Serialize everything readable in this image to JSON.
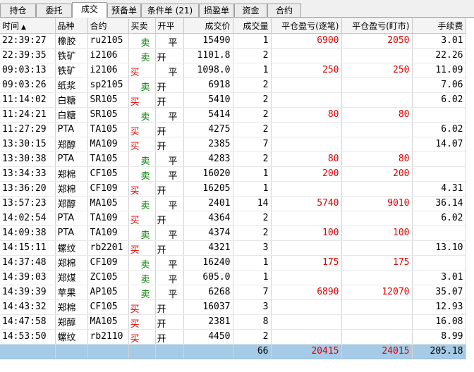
{
  "tabs": [
    "持仓",
    "委托",
    "成交",
    "预备单",
    "条件单 (21)",
    "损盈单",
    "资金",
    "合约"
  ],
  "active_tab": "成交",
  "columns": [
    "时间",
    "品种",
    "合约",
    "买卖",
    "开平",
    "成交价",
    "成交量",
    "平仓盈亏(逐笔)",
    "平仓盈亏(盯市)",
    "手续费"
  ],
  "sort_indicator": "▲",
  "rows": [
    {
      "time": "22:39:27",
      "product": "橡胶",
      "contract": "ru2105",
      "side": "卖",
      "oc": "平",
      "price": "15490",
      "qty": "1",
      "pnl_trade": "6900",
      "pnl_mtm": "2050",
      "fee": "3.01"
    },
    {
      "time": "22:39:35",
      "product": "铁矿",
      "contract": "i2106",
      "side": "卖",
      "oc": "开",
      "price": "1101.8",
      "qty": "2",
      "pnl_trade": "",
      "pnl_mtm": "",
      "fee": "22.26"
    },
    {
      "time": "09:03:13",
      "product": "铁矿",
      "contract": "i2106",
      "side": "买",
      "oc": "平",
      "price": "1098.0",
      "qty": "1",
      "pnl_trade": "250",
      "pnl_mtm": "250",
      "fee": "11.09"
    },
    {
      "time": "09:03:26",
      "product": "纸浆",
      "contract": "sp2105",
      "side": "卖",
      "oc": "开",
      "price": "6918",
      "qty": "2",
      "pnl_trade": "",
      "pnl_mtm": "",
      "fee": "7.06"
    },
    {
      "time": "11:14:02",
      "product": "白糖",
      "contract": "SR105",
      "side": "买",
      "oc": "开",
      "price": "5410",
      "qty": "2",
      "pnl_trade": "",
      "pnl_mtm": "",
      "fee": "6.02"
    },
    {
      "time": "11:24:21",
      "product": "白糖",
      "contract": "SR105",
      "side": "卖",
      "oc": "平",
      "price": "5414",
      "qty": "2",
      "pnl_trade": "80",
      "pnl_mtm": "80",
      "fee": ""
    },
    {
      "time": "11:27:29",
      "product": "PTA",
      "contract": "TA105",
      "side": "买",
      "oc": "开",
      "price": "4275",
      "qty": "2",
      "pnl_trade": "",
      "pnl_mtm": "",
      "fee": "6.02"
    },
    {
      "time": "13:30:15",
      "product": "郑醇",
      "contract": "MA109",
      "side": "买",
      "oc": "开",
      "price": "2385",
      "qty": "7",
      "pnl_trade": "",
      "pnl_mtm": "",
      "fee": "14.07"
    },
    {
      "time": "13:30:38",
      "product": "PTA",
      "contract": "TA105",
      "side": "卖",
      "oc": "平",
      "price": "4283",
      "qty": "2",
      "pnl_trade": "80",
      "pnl_mtm": "80",
      "fee": ""
    },
    {
      "time": "13:34:33",
      "product": "郑棉",
      "contract": "CF105",
      "side": "卖",
      "oc": "平",
      "price": "16020",
      "qty": "1",
      "pnl_trade": "200",
      "pnl_mtm": "200",
      "fee": ""
    },
    {
      "time": "13:36:20",
      "product": "郑棉",
      "contract": "CF109",
      "side": "买",
      "oc": "开",
      "price": "16205",
      "qty": "1",
      "pnl_trade": "",
      "pnl_mtm": "",
      "fee": "4.31"
    },
    {
      "time": "13:57:23",
      "product": "郑醇",
      "contract": "MA105",
      "side": "卖",
      "oc": "平",
      "price": "2401",
      "qty": "14",
      "pnl_trade": "5740",
      "pnl_mtm": "9010",
      "fee": "36.14"
    },
    {
      "time": "14:02:54",
      "product": "PTA",
      "contract": "TA109",
      "side": "买",
      "oc": "开",
      "price": "4364",
      "qty": "2",
      "pnl_trade": "",
      "pnl_mtm": "",
      "fee": "6.02"
    },
    {
      "time": "14:09:38",
      "product": "PTA",
      "contract": "TA109",
      "side": "卖",
      "oc": "平",
      "price": "4374",
      "qty": "2",
      "pnl_trade": "100",
      "pnl_mtm": "100",
      "fee": ""
    },
    {
      "time": "14:15:11",
      "product": "螺纹",
      "contract": "rb2201",
      "side": "买",
      "oc": "开",
      "price": "4321",
      "qty": "3",
      "pnl_trade": "",
      "pnl_mtm": "",
      "fee": "13.10"
    },
    {
      "time": "14:37:48",
      "product": "郑棉",
      "contract": "CF109",
      "side": "卖",
      "oc": "平",
      "price": "16240",
      "qty": "1",
      "pnl_trade": "175",
      "pnl_mtm": "175",
      "fee": ""
    },
    {
      "time": "14:39:03",
      "product": "郑煤",
      "contract": "ZC105",
      "side": "卖",
      "oc": "平",
      "price": "605.0",
      "qty": "1",
      "pnl_trade": "",
      "pnl_mtm": "",
      "fee": "3.01"
    },
    {
      "time": "14:39:39",
      "product": "苹果",
      "contract": "AP105",
      "side": "卖",
      "oc": "平",
      "price": "6268",
      "qty": "7",
      "pnl_trade": "6890",
      "pnl_mtm": "12070",
      "fee": "35.07"
    },
    {
      "time": "14:43:32",
      "product": "郑棉",
      "contract": "CF105",
      "side": "买",
      "oc": "开",
      "price": "16037",
      "qty": "3",
      "pnl_trade": "",
      "pnl_mtm": "",
      "fee": "12.93"
    },
    {
      "time": "14:47:58",
      "product": "郑醇",
      "contract": "MA105",
      "side": "买",
      "oc": "开",
      "price": "2381",
      "qty": "8",
      "pnl_trade": "",
      "pnl_mtm": "",
      "fee": "16.08"
    },
    {
      "time": "14:53:50",
      "product": "螺纹",
      "contract": "rb2110",
      "side": "买",
      "oc": "开",
      "price": "4450",
      "qty": "2",
      "pnl_trade": "",
      "pnl_mtm": "",
      "fee": "8.99"
    }
  ],
  "totals": {
    "qty": "66",
    "pnl_trade": "20415",
    "pnl_mtm": "24015",
    "fee": "205.18"
  },
  "colors": {
    "buy": "#e00000",
    "sell": "#008000",
    "profit": "#e00000",
    "total_row": "#a6cbe6"
  }
}
